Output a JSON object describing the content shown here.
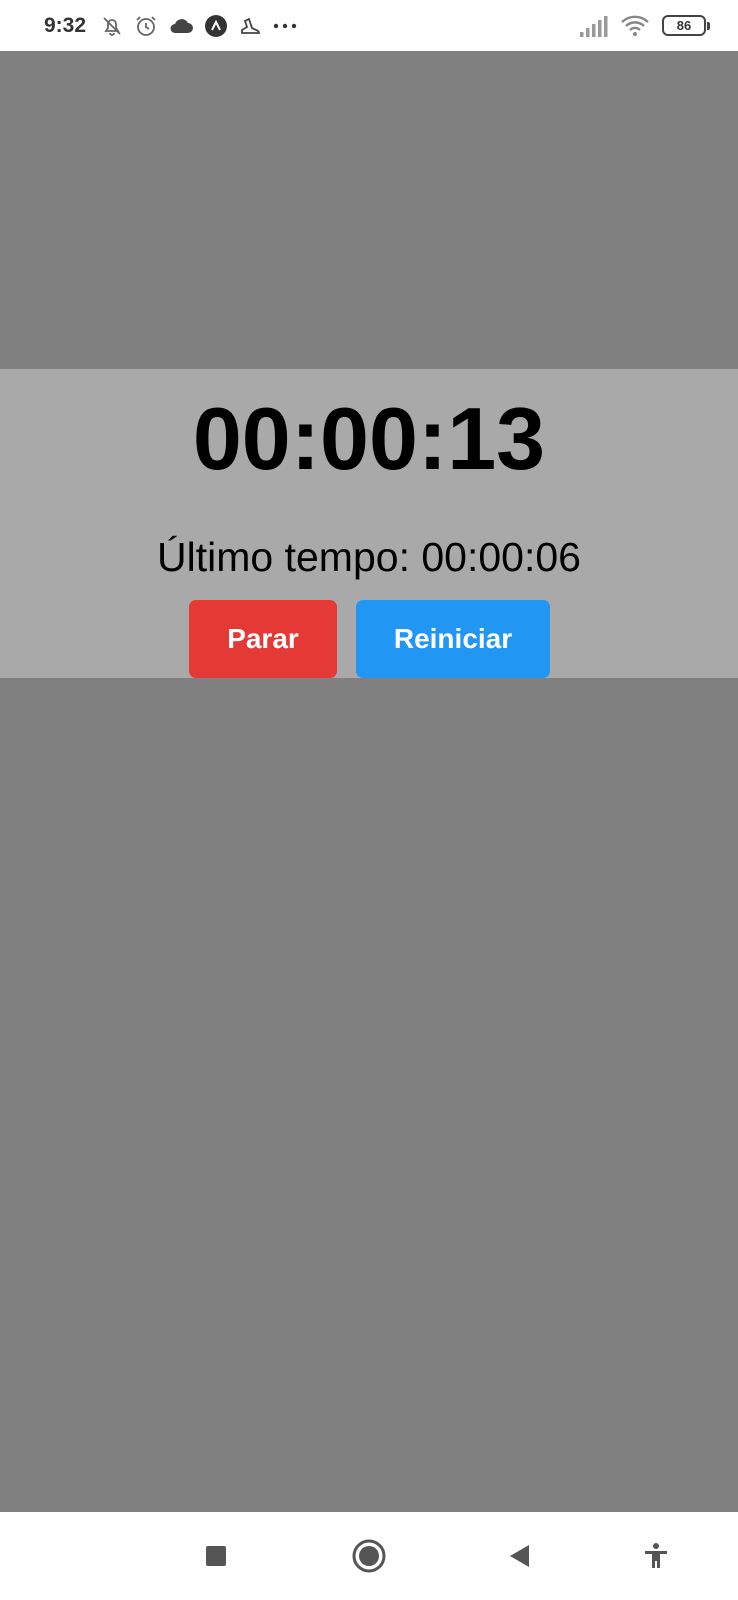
{
  "status_bar": {
    "time": "9:32",
    "battery": "86",
    "icons": [
      "bell-off-icon",
      "alarm-icon",
      "cloud-icon",
      "app-circle-icon",
      "shoe-icon",
      "more-dots-icon",
      "signal-icon",
      "wifi-icon",
      "battery-icon"
    ]
  },
  "stopwatch": {
    "elapsed": "00:00:13",
    "last_time": "Último tempo: 00:00:06",
    "stop_label": "Parar",
    "reset_label": "Reiniciar"
  },
  "colors": {
    "overlay": "#808080",
    "panel": "#a9a9a9",
    "stop_button": "#e53935",
    "reset_button": "#2196f3"
  },
  "nav_bar": {
    "icons": [
      "recents-square-icon",
      "home-circle-icon",
      "back-triangle-icon",
      "accessibility-icon"
    ]
  }
}
